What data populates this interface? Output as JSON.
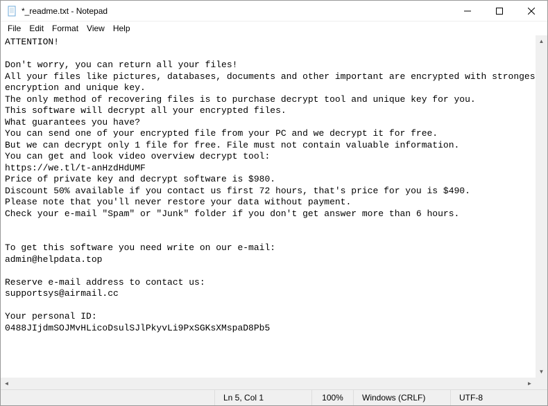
{
  "titlebar": {
    "title": "*_readme.txt - Notepad"
  },
  "menubar": {
    "items": [
      "File",
      "Edit",
      "Format",
      "View",
      "Help"
    ]
  },
  "content": {
    "text": "ATTENTION!\n\nDon't worry, you can return all your files!\nAll your files like pictures, databases, documents and other important are encrypted with strongest encryption and unique key.\nThe only method of recovering files is to purchase decrypt tool and unique key for you.\nThis software will decrypt all your encrypted files.\nWhat guarantees you have?\nYou can send one of your encrypted file from your PC and we decrypt it for free.\nBut we can decrypt only 1 file for free. File must not contain valuable information.\nYou can get and look video overview decrypt tool:\nhttps://we.tl/t-anHzdHdUMF\nPrice of private key and decrypt software is $980.\nDiscount 50% available if you contact us first 72 hours, that's price for you is $490.\nPlease note that you'll never restore your data without payment.\nCheck your e-mail \"Spam\" or \"Junk\" folder if you don't get answer more than 6 hours.\n\n\nTo get this software you need write on our e-mail:\nadmin@helpdata.top\n\nReserve e-mail address to contact us:\nsupportsys@airmail.cc\n\nYour personal ID:\n0488JIjdmSOJMvHLicoDsulSJlPkyvLi9PxSGKsXMspaD8Pb5"
  },
  "statusbar": {
    "position": "Ln 5, Col 1",
    "zoom": "100%",
    "lineending": "Windows (CRLF)",
    "encoding": "UTF-8"
  }
}
